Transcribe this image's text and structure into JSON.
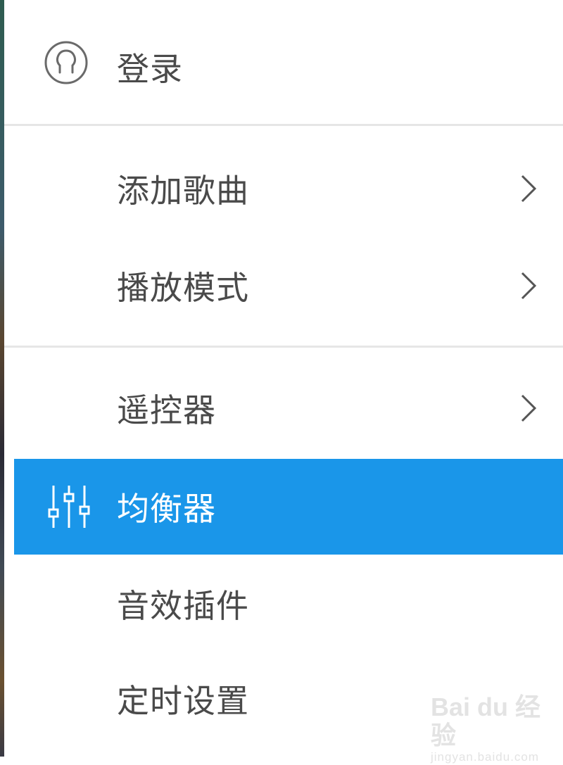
{
  "login": {
    "label": "登录",
    "icon": "user-circle-icon"
  },
  "menu": {
    "items": [
      {
        "label": "添加歌曲",
        "has_submenu": true
      },
      {
        "label": "播放模式",
        "has_submenu": true
      },
      {
        "label": "遥控器",
        "has_submenu": true
      },
      {
        "label": "均衡器",
        "has_submenu": false,
        "selected": true,
        "icon": "equalizer-icon"
      },
      {
        "label": "音效插件",
        "has_submenu": false
      },
      {
        "label": "定时设置",
        "has_submenu": false
      }
    ]
  },
  "colors": {
    "selected_bg": "#1a96e9",
    "text": "#4a4a4a",
    "divider": "#e6e6e6"
  },
  "watermark": {
    "top": "Bai du 经验",
    "bottom": "jingyan.baidu.com"
  }
}
